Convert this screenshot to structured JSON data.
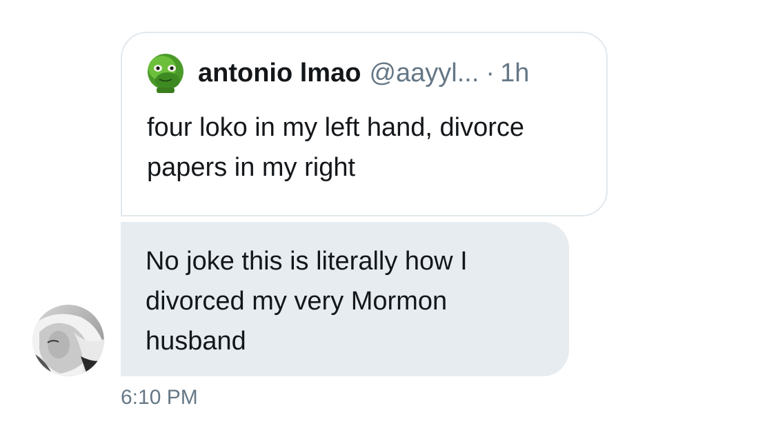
{
  "quoted_tweet": {
    "author_name": "antonio lmao",
    "author_handle": "@aayyl...",
    "separator": "·",
    "time": "1h",
    "text": "four loko in my left hand, divorce papers in my right",
    "avatar_icon": "green-alien-head-icon"
  },
  "message": {
    "text": "No joke this is literally how I divorced my very Mormon husband",
    "timestamp": "6:10 PM",
    "sender_avatar_icon": "profile-photo-icon"
  },
  "colors": {
    "bubble_bg": "#e6ecf0",
    "secondary_text": "#657786",
    "primary_text": "#14171a",
    "card_border": "#e1e8ed"
  }
}
